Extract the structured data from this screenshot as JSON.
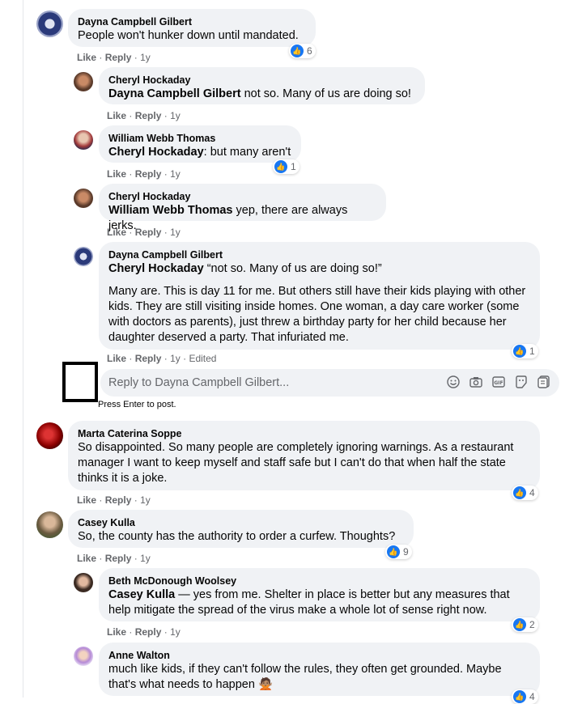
{
  "actions": {
    "like": "Like",
    "reply": "Reply",
    "sep": "·"
  },
  "colors": {
    "accent": "#1877f2",
    "bubble": "#f0f2f5",
    "meta": "#65676b"
  },
  "comments": [
    {
      "author": "Dayna Campbell Gilbert",
      "mention": "",
      "text": "People won't hunker down until mandated.",
      "age": "1y",
      "edited": "",
      "reactions": "6"
    },
    {
      "author": "Cheryl Hockaday",
      "mention": "Dayna Campbell Gilbert",
      "text": " not so. Many of us are doing so!",
      "age": "1y",
      "edited": "",
      "reactions": ""
    },
    {
      "author": "William Webb Thomas",
      "mention": "Cheryl Hockaday",
      "text": ": but many aren't",
      "age": "1y",
      "edited": "",
      "reactions": "1"
    },
    {
      "author": "Cheryl Hockaday",
      "mention": "William Webb Thomas",
      "text": " yep, there are always jerks.",
      "age": "1y",
      "edited": "",
      "reactions": ""
    },
    {
      "author": "Dayna Campbell Gilbert",
      "mention": "Cheryl Hockaday",
      "text": " “not so. Many of us are doing so!”",
      "text2": "Many are. This is day 11 for me. But others still have their kids playing with other kids. They are still visiting inside homes. One woman, a day care worker (some with doctors as parents), just threw a birthday party for her child because her daughter deserved a party. That infuriated me.",
      "age": "1y",
      "edited": "Edited",
      "reactions": "1"
    },
    {
      "author": "Marta Caterina Soppe",
      "mention": "",
      "text": "So disappointed. So many people are completely ignoring warnings. As a restaurant manager I want to keep myself and staff safe but I can't do that when half the state thinks it is a joke.",
      "age": "1y",
      "edited": "",
      "reactions": "4"
    },
    {
      "author": "Casey Kulla",
      "mention": "",
      "text": "So, the county has the authority to order a curfew. Thoughts?",
      "age": "1y",
      "edited": "",
      "reactions": "9"
    },
    {
      "author": "Beth McDonough Woolsey",
      "mention": "Casey Kulla",
      "text": " — yes from me. Shelter in place is better but any measures that help mitigate the spread of the virus make a whole lot of sense right now.",
      "age": "1y",
      "edited": "",
      "reactions": "2"
    },
    {
      "author": "Anne Walton",
      "mention": "",
      "text": "much like kids, if they can't follow the rules, they often get grounded. Maybe that's what needs to happen 🙅🏽",
      "age": "",
      "edited": "",
      "reactions": "4"
    }
  ],
  "reply_box": {
    "placeholder": "Reply to Dayna Campbell Gilbert...",
    "hint": "Press Enter to post."
  },
  "icons": [
    "smile-icon",
    "camera-icon",
    "gif-icon",
    "sticker-icon",
    "attachment-icon"
  ]
}
